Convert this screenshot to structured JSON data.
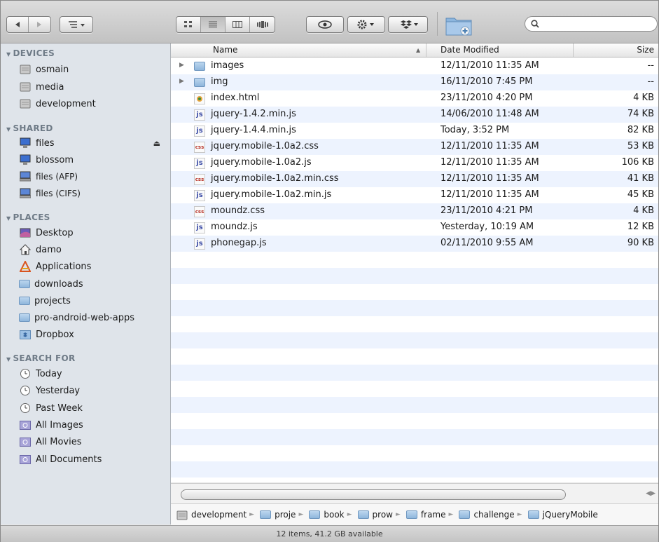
{
  "toolbar": {
    "nav_back_icon": "back-arrow-icon",
    "nav_forward_icon": "forward-arrow-icon",
    "arrange_icon": "arrange-menu-icon",
    "view_modes": [
      "icon-view",
      "list-view",
      "column-view",
      "coverflow-view"
    ],
    "active_view": "list-view",
    "quicklook_icon": "eye-icon",
    "action_icon": "gear-icon",
    "dropbox_icon": "dropbox-icon",
    "new_folder_icon": "new-folder-icon",
    "search_placeholder": ""
  },
  "sidebar": {
    "sections": [
      {
        "title": "DEVICES",
        "items": [
          {
            "label": "osmain",
            "icon": "disk-icon"
          },
          {
            "label": "media",
            "icon": "disk-icon"
          },
          {
            "label": "development",
            "icon": "disk-icon"
          }
        ]
      },
      {
        "title": "SHARED",
        "items": [
          {
            "label": "files",
            "icon": "monitor-icon"
          },
          {
            "label": "blossom",
            "icon": "monitor-icon"
          },
          {
            "label": "files (AFP)",
            "icon": "network-monitor-icon"
          },
          {
            "label": "files (CIFS)",
            "icon": "network-monitor-icon"
          }
        ]
      },
      {
        "title": "PLACES",
        "items": [
          {
            "label": "Desktop",
            "icon": "desktop-icon"
          },
          {
            "label": "damo",
            "icon": "home-icon"
          },
          {
            "label": "Applications",
            "icon": "applications-icon"
          },
          {
            "label": "downloads",
            "icon": "folder-icon"
          },
          {
            "label": "projects",
            "icon": "folder-icon"
          },
          {
            "label": "pro-android-web-apps",
            "icon": "folder-icon"
          },
          {
            "label": "Dropbox",
            "icon": "dropbox-folder-icon"
          }
        ]
      },
      {
        "title": "SEARCH FOR",
        "items": [
          {
            "label": "Today",
            "icon": "clock-icon"
          },
          {
            "label": "Yesterday",
            "icon": "clock-icon"
          },
          {
            "label": "Past Week",
            "icon": "clock-icon"
          },
          {
            "label": "All Images",
            "icon": "smart-folder-icon"
          },
          {
            "label": "All Movies",
            "icon": "smart-folder-icon"
          },
          {
            "label": "All Documents",
            "icon": "smart-folder-icon"
          }
        ]
      }
    ]
  },
  "list": {
    "columns": {
      "name": "Name",
      "date": "Date Modified",
      "size": "Size"
    },
    "rows": [
      {
        "name": "images",
        "date": "12/11/2010 11:35 AM",
        "size": "--",
        "kind": "folder"
      },
      {
        "name": "img",
        "date": "16/11/2010 7:45 PM",
        "size": "--",
        "kind": "folder"
      },
      {
        "name": "index.html",
        "date": "23/11/2010 4:20 PM",
        "size": "4 KB",
        "kind": "html"
      },
      {
        "name": "jquery-1.4.2.min.js",
        "date": "14/06/2010 11:48 AM",
        "size": "74 KB",
        "kind": "js"
      },
      {
        "name": "jquery-1.4.4.min.js",
        "date": "Today, 3:52 PM",
        "size": "82 KB",
        "kind": "js"
      },
      {
        "name": "jquery.mobile-1.0a2.css",
        "date": "12/11/2010 11:35 AM",
        "size": "53 KB",
        "kind": "css"
      },
      {
        "name": "jquery.mobile-1.0a2.js",
        "date": "12/11/2010 11:35 AM",
        "size": "106 KB",
        "kind": "js"
      },
      {
        "name": "jquery.mobile-1.0a2.min.css",
        "date": "12/11/2010 11:35 AM",
        "size": "41 KB",
        "kind": "css"
      },
      {
        "name": "jquery.mobile-1.0a2.min.js",
        "date": "12/11/2010 11:35 AM",
        "size": "45 KB",
        "kind": "js"
      },
      {
        "name": "moundz.css",
        "date": "23/11/2010 4:21 PM",
        "size": "4 KB",
        "kind": "css"
      },
      {
        "name": "moundz.js",
        "date": "Yesterday, 10:19 AM",
        "size": "12 KB",
        "kind": "js"
      },
      {
        "name": "phonegap.js",
        "date": "02/11/2010 9:55 AM",
        "size": "90 KB",
        "kind": "js"
      }
    ]
  },
  "pathbar": [
    "development",
    "proje",
    "book",
    "prow",
    "frame",
    "challenge",
    "jQueryMobile"
  ],
  "status": "12 items, 41.2 GB available",
  "file_icon_text": {
    "js": "js",
    "css": "css"
  }
}
